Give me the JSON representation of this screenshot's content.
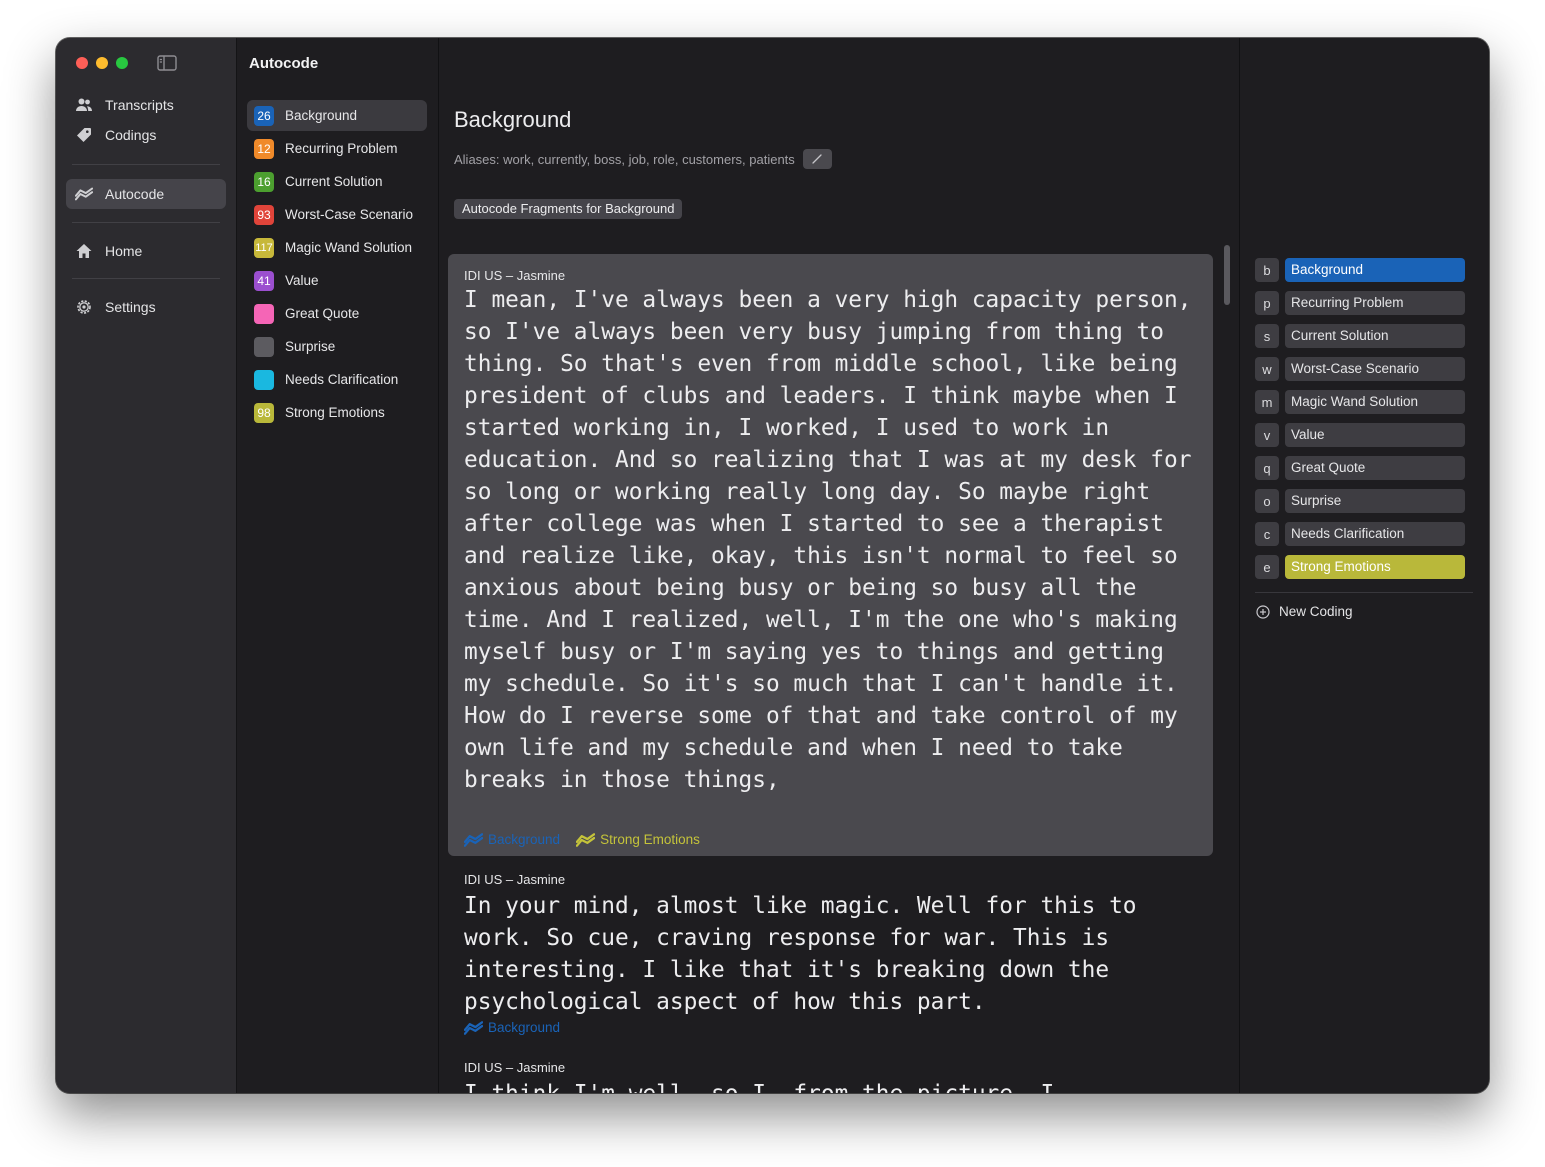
{
  "app": {
    "title": "Autocode"
  },
  "sidebar": {
    "items": [
      {
        "label": "Transcripts",
        "icon": "people-icon"
      },
      {
        "label": "Codings",
        "icon": "tag-icon"
      },
      {
        "label": "Autocode",
        "icon": "autocode-icon",
        "active": true
      },
      {
        "label": "Home",
        "icon": "home-icon"
      },
      {
        "label": "Settings",
        "icon": "gear-icon"
      }
    ]
  },
  "codes": [
    {
      "count": "26",
      "label": "Background",
      "color": "#1a63b7",
      "active": true
    },
    {
      "count": "12",
      "label": "Recurring Problem",
      "color": "#f08a2a"
    },
    {
      "count": "16",
      "label": "Current Solution",
      "color": "#4c9f2f"
    },
    {
      "count": "93",
      "label": "Worst-Case Scenario",
      "color": "#e0443a"
    },
    {
      "count": "117",
      "label": "Magic Wand Solution",
      "color": "#c7b83a"
    },
    {
      "count": "41",
      "label": "Value",
      "color": "#9b4fcf"
    },
    {
      "count": "",
      "label": "Great Quote",
      "color": "#f565b6"
    },
    {
      "count": "",
      "label": "Surprise",
      "color": "#5c5b60"
    },
    {
      "count": "",
      "label": "Needs Clarification",
      "color": "#1ab8e0"
    },
    {
      "count": "98",
      "label": "Strong Emotions",
      "color": "#b9b83a"
    }
  ],
  "main": {
    "title": "Background",
    "aliases": "Aliases: work, currently, boss, job, role, customers, patients",
    "fragments_label": "Autocode Fragments for Background",
    "fragments": [
      {
        "source": "IDI US – Jasmine",
        "text": "I mean, I've always been a very high capacity person, so I've always been very busy jumping from thing to thing. So that's even from middle school, like being president of clubs and leaders. I think maybe when I started working in, I worked, I used to work in education. And so realizing that I was at my desk for so long or working really long day. So maybe right after college was when I started to see a therapist and realize like, okay, this isn't normal to feel so anxious about being busy or being so busy all the time. And I realized, well, I'm the one who's making myself busy or I'm saying yes to things and getting my schedule. So it's so much that I can't handle it. How do I reverse some of that and take control of my own life and my schedule and when I need to take breaks in those things,",
        "tags": [
          {
            "label": "Background",
            "color": "#1a63b7"
          },
          {
            "label": "Strong Emotions",
            "color": "#c4c33a"
          }
        ]
      },
      {
        "source": "IDI US – Jasmine",
        "text": "In your mind, almost like magic. Well for this to work. So cue, craving response for war. This is interesting. I like that it's breaking down the psychological aspect of how this part.",
        "tags": [
          {
            "label": "Background",
            "color": "#1a63b7"
          }
        ]
      },
      {
        "source": "IDI US – Jasmine",
        "text": "I think I'm well, so I, from the picture, I",
        "tags": []
      }
    ]
  },
  "shortcuts": [
    {
      "key": "b",
      "label": "Background",
      "color": "#1a63b7",
      "selected": true
    },
    {
      "key": "p",
      "label": "Recurring Problem",
      "color": "#3e3d42"
    },
    {
      "key": "s",
      "label": "Current Solution",
      "color": "#3e3d42"
    },
    {
      "key": "w",
      "label": "Worst-Case Scenario",
      "color": "#3e3d42"
    },
    {
      "key": "m",
      "label": "Magic Wand Solution",
      "color": "#3e3d42"
    },
    {
      "key": "v",
      "label": "Value",
      "color": "#3e3d42"
    },
    {
      "key": "q",
      "label": "Great Quote",
      "color": "#3e3d42"
    },
    {
      "key": "o",
      "label": "Surprise",
      "color": "#3e3d42"
    },
    {
      "key": "c",
      "label": "Needs Clarification",
      "color": "#3e3d42"
    },
    {
      "key": "e",
      "label": "Strong Emotions",
      "color": "#b9b83a",
      "selected": true
    }
  ],
  "new_coding_label": "New Coding"
}
